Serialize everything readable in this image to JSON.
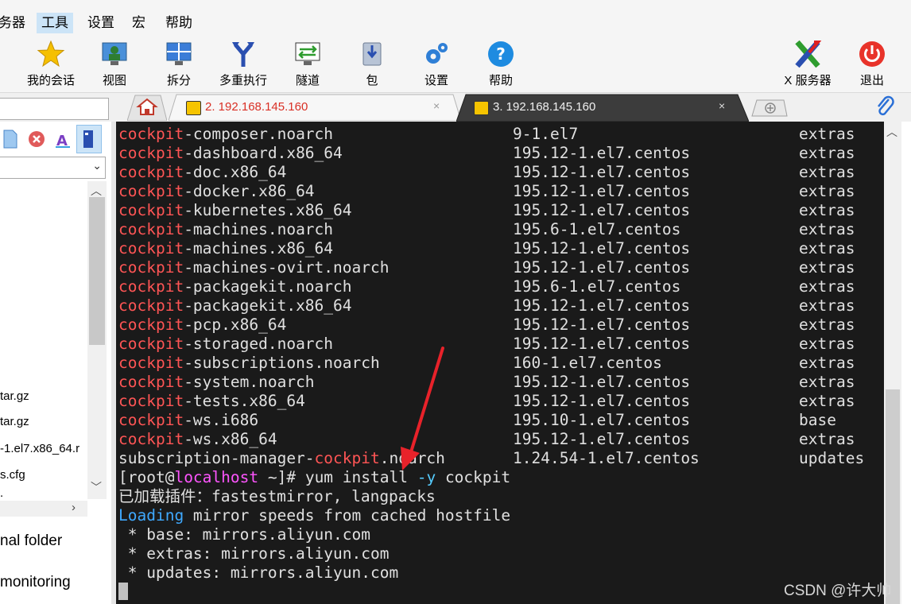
{
  "menu": [
    "务器",
    "工具",
    "设置",
    "宏",
    "帮助"
  ],
  "toolbar": {
    "my_sessions": "我的会话",
    "view": "视图",
    "split": "拆分",
    "multi_exec": "多重执行",
    "tunnel": "隧道",
    "package": "包",
    "settings": "设置",
    "help": "帮助",
    "xserver": "X 服务器",
    "exit": "退出"
  },
  "tabs": [
    {
      "title": "2. 192.168.145.160",
      "close": "×"
    },
    {
      "title": "3. 192.168.145.160",
      "close": "×"
    }
  ],
  "left_files": [
    "tar.gz",
    "tar.gz",
    "-1.el7.x86_64.r",
    "s.cfg",
    "."
  ],
  "left_items": [
    "nal folder",
    "monitoring"
  ],
  "terminal": {
    "packages": [
      {
        "prefix": "cockpit",
        "rest": "-composer.noarch",
        "version": "9-1.el7",
        "repo": "extras"
      },
      {
        "prefix": "cockpit",
        "rest": "-dashboard.x86_64",
        "version": "195.12-1.el7.centos",
        "repo": "extras"
      },
      {
        "prefix": "cockpit",
        "rest": "-doc.x86_64",
        "version": "195.12-1.el7.centos",
        "repo": "extras"
      },
      {
        "prefix": "cockpit",
        "rest": "-docker.x86_64",
        "version": "195.12-1.el7.centos",
        "repo": "extras"
      },
      {
        "prefix": "cockpit",
        "rest": "-kubernetes.x86_64",
        "version": "195.12-1.el7.centos",
        "repo": "extras"
      },
      {
        "prefix": "cockpit",
        "rest": "-machines.noarch",
        "version": "195.6-1.el7.centos",
        "repo": "extras"
      },
      {
        "prefix": "cockpit",
        "rest": "-machines.x86_64",
        "version": "195.12-1.el7.centos",
        "repo": "extras"
      },
      {
        "prefix": "cockpit",
        "rest": "-machines-ovirt.noarch",
        "version": "195.12-1.el7.centos",
        "repo": "extras"
      },
      {
        "prefix": "cockpit",
        "rest": "-packagekit.noarch",
        "version": "195.6-1.el7.centos",
        "repo": "extras"
      },
      {
        "prefix": "cockpit",
        "rest": "-packagekit.x86_64",
        "version": "195.12-1.el7.centos",
        "repo": "extras"
      },
      {
        "prefix": "cockpit",
        "rest": "-pcp.x86_64",
        "version": "195.12-1.el7.centos",
        "repo": "extras"
      },
      {
        "prefix": "cockpit",
        "rest": "-storaged.noarch",
        "version": "195.12-1.el7.centos",
        "repo": "extras"
      },
      {
        "prefix": "cockpit",
        "rest": "-subscriptions.noarch",
        "version": "160-1.el7.centos",
        "repo": "extras"
      },
      {
        "prefix": "cockpit",
        "rest": "-system.noarch",
        "version": "195.12-1.el7.centos",
        "repo": "extras"
      },
      {
        "prefix": "cockpit",
        "rest": "-tests.x86_64",
        "version": "195.12-1.el7.centos",
        "repo": "extras"
      },
      {
        "prefix": "cockpit",
        "rest": "-ws.i686",
        "version": "195.10-1.el7.centos",
        "repo": "base"
      },
      {
        "prefix": "cockpit",
        "rest": "-ws.x86_64",
        "version": "195.12-1.el7.centos",
        "repo": "extras"
      }
    ],
    "sub_manager": {
      "pre": "subscription-manager-",
      "hl": "cockpit",
      "post": ".noarch",
      "version": "1.24.54-1.el7.centos",
      "repo": "updates"
    },
    "prompt": {
      "open": "[root@",
      "host": "localhost",
      "close": " ~]# ",
      "cmd1": "yum install ",
      "flag": "-y",
      "cmd2": " cockpit"
    },
    "plugins_line": "已加载插件：fastestmirror, langpacks",
    "loading": {
      "word": "Loading",
      "rest": " mirror speeds from cached hostfile"
    },
    "mirrors": [
      " * base: mirrors.aliyun.com",
      " * extras: mirrors.aliyun.com",
      " * updates: mirrors.aliyun.com"
    ]
  },
  "watermark": "CSDN @许大帅",
  "colors": {
    "terminal_bg": "#1a1a1a",
    "highlight_red": "#ff5555",
    "host_magenta": "#ff55ff",
    "arrow": "#e8222a"
  }
}
